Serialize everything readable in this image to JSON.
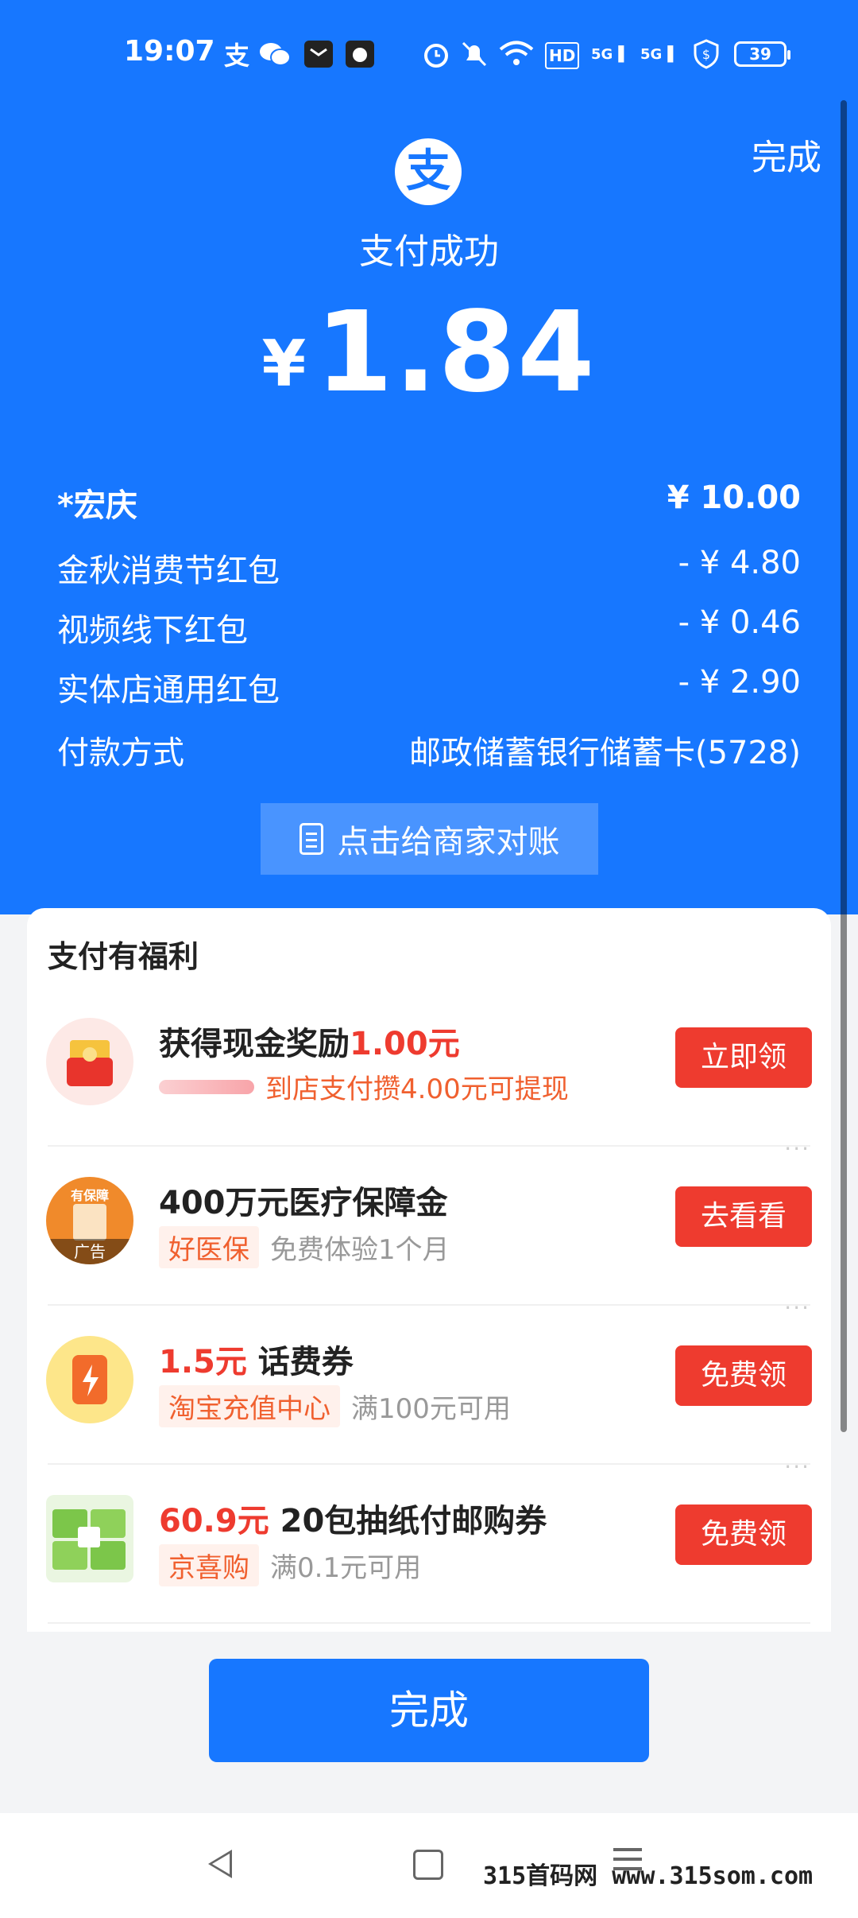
{
  "status_bar": {
    "time": "19:07",
    "battery": "39",
    "net_labels": [
      "HD",
      "5G",
      "5G"
    ]
  },
  "header": {
    "done_label": "完成",
    "title": "支付成功",
    "currency": "¥",
    "amount": "1.84"
  },
  "details": [
    {
      "label": "*宏庆",
      "value": "¥ 10.00"
    },
    {
      "label": "金秋消费节红包",
      "value": "- ¥ 4.80"
    },
    {
      "label": "视频线下红包",
      "value": "- ¥ 0.46"
    },
    {
      "label": "实体店通用红包",
      "value": "- ¥ 2.90"
    },
    {
      "label": "付款方式",
      "value": "邮政储蓄银行储蓄卡(5728)"
    }
  ],
  "reconcile_label": "点击给商家对账",
  "benefits": {
    "title": "支付有福利",
    "items": [
      {
        "title_prefix": "获得现金奖励",
        "title_red": "1.00元",
        "sub_text": "到店支付攒4.00元可提现",
        "button": "立即领"
      },
      {
        "title": "400万元医疗保障金",
        "tag": "好医保",
        "sub_text": "免费体验1个月",
        "button": "去看看",
        "thumb_label_top": "有保障",
        "thumb_label": "广告"
      },
      {
        "title_red": "1.5元",
        "title_suffix": " 话费券",
        "tag": "淘宝充值中心",
        "sub_text": "满100元可用",
        "button": "免费领"
      },
      {
        "title_red": "60.9元",
        "title_suffix": " 20包抽纸付邮购券",
        "tag": "京喜购",
        "sub_text": "满0.1元可用",
        "button": "免费领"
      }
    ],
    "more_label": "···"
  },
  "bottom_button": "完成",
  "watermark": "315首码网 www.315som.com",
  "colors": {
    "primary": "#1777ff",
    "accent_red": "#ee3b2f",
    "tag_orange": "#f0602f"
  }
}
